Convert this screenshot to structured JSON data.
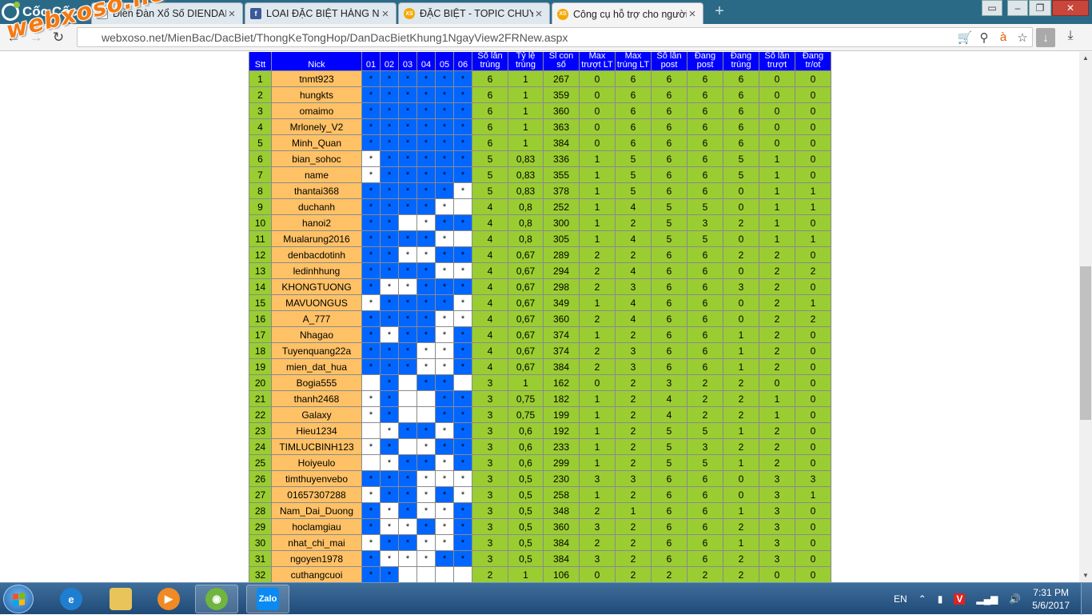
{
  "browser": {
    "brand": "Cốc Cốc",
    "tabs": [
      {
        "title": "Diễn Đàn Xổ Số DIENDAN",
        "icon": "page"
      },
      {
        "title": "LOAI ĐẶC BIỆT HÀNG NGÀY",
        "icon": "fb"
      },
      {
        "title": "ĐẶC BIỆT - TOPIC CHUYÊN",
        "icon": "xs"
      },
      {
        "title": "Công cụ hỗ trợ cho người",
        "icon": "xs"
      }
    ],
    "url": "webxoso.net/MienBac/DacBiet/ThongKeTongHop/DanDacBietKhung1NgayView2FRNew.aspx",
    "watermark": "webxoso.net"
  },
  "table": {
    "headers": [
      "Stt",
      "Nick",
      "01",
      "02",
      "03",
      "04",
      "05",
      "06",
      "Số lần trúng",
      "Tỷ lệ trúng",
      "Sl con số",
      "Max trượt LT",
      "Max trúng LT",
      "Số lần post",
      "Đang post",
      "Đang trúng",
      "Số lần trượt",
      "Đang tr/ot"
    ],
    "rows": [
      {
        "stt": "1",
        "nick": "tnmt923",
        "m": [
          1,
          1,
          1,
          1,
          1,
          1
        ],
        "v": [
          "6",
          "1",
          "267",
          "0",
          "6",
          "6",
          "6",
          "6",
          "0",
          "0"
        ]
      },
      {
        "stt": "2",
        "nick": "hungkts",
        "m": [
          1,
          1,
          1,
          1,
          1,
          1
        ],
        "v": [
          "6",
          "1",
          "359",
          "0",
          "6",
          "6",
          "6",
          "6",
          "0",
          "0"
        ]
      },
      {
        "stt": "3",
        "nick": "omaimo",
        "m": [
          1,
          1,
          1,
          1,
          1,
          1
        ],
        "v": [
          "6",
          "1",
          "360",
          "0",
          "6",
          "6",
          "6",
          "6",
          "0",
          "0"
        ]
      },
      {
        "stt": "4",
        "nick": "Mrlonely_V2",
        "m": [
          1,
          1,
          1,
          1,
          1,
          1
        ],
        "v": [
          "6",
          "1",
          "363",
          "0",
          "6",
          "6",
          "6",
          "6",
          "0",
          "0"
        ]
      },
      {
        "stt": "5",
        "nick": "Minh_Quan",
        "m": [
          1,
          1,
          1,
          1,
          1,
          1
        ],
        "v": [
          "6",
          "1",
          "384",
          "0",
          "6",
          "6",
          "6",
          "6",
          "0",
          "0"
        ]
      },
      {
        "stt": "6",
        "nick": "bian_sohoc",
        "m": [
          0,
          1,
          1,
          1,
          1,
          1
        ],
        "v": [
          "5",
          "0,83",
          "336",
          "1",
          "5",
          "6",
          "6",
          "5",
          "1",
          "0"
        ]
      },
      {
        "stt": "7",
        "nick": "name",
        "m": [
          0,
          1,
          1,
          1,
          1,
          1
        ],
        "v": [
          "5",
          "0,83",
          "355",
          "1",
          "5",
          "6",
          "6",
          "5",
          "1",
          "0"
        ]
      },
      {
        "stt": "8",
        "nick": "thantai368",
        "m": [
          1,
          1,
          1,
          1,
          1,
          0
        ],
        "v": [
          "5",
          "0,83",
          "378",
          "1",
          "5",
          "6",
          "6",
          "0",
          "1",
          "1"
        ]
      },
      {
        "stt": "9",
        "nick": "duchanh",
        "m": [
          1,
          1,
          1,
          1,
          0,
          2
        ],
        "v": [
          "4",
          "0,8",
          "252",
          "1",
          "4",
          "5",
          "5",
          "0",
          "1",
          "1"
        ]
      },
      {
        "stt": "10",
        "nick": "hanoi2",
        "m": [
          1,
          1,
          2,
          0,
          1,
          1
        ],
        "v": [
          "4",
          "0,8",
          "300",
          "1",
          "2",
          "5",
          "3",
          "2",
          "1",
          "0"
        ]
      },
      {
        "stt": "11",
        "nick": "Mualarung2016",
        "m": [
          1,
          1,
          1,
          1,
          0,
          2
        ],
        "v": [
          "4",
          "0,8",
          "305",
          "1",
          "4",
          "5",
          "5",
          "0",
          "1",
          "1"
        ]
      },
      {
        "stt": "12",
        "nick": "denbacdotinh",
        "m": [
          1,
          1,
          0,
          0,
          1,
          1
        ],
        "v": [
          "4",
          "0,67",
          "289",
          "2",
          "2",
          "6",
          "6",
          "2",
          "2",
          "0"
        ]
      },
      {
        "stt": "13",
        "nick": "ledinhhung",
        "m": [
          1,
          1,
          1,
          1,
          0,
          0
        ],
        "v": [
          "4",
          "0,67",
          "294",
          "2",
          "4",
          "6",
          "6",
          "0",
          "2",
          "2"
        ]
      },
      {
        "stt": "14",
        "nick": "KHONGTUONG",
        "m": [
          1,
          0,
          0,
          1,
          1,
          1
        ],
        "v": [
          "4",
          "0,67",
          "298",
          "2",
          "3",
          "6",
          "6",
          "3",
          "2",
          "0"
        ]
      },
      {
        "stt": "15",
        "nick": "MAVUONGUS",
        "m": [
          0,
          1,
          1,
          1,
          1,
          0
        ],
        "v": [
          "4",
          "0,67",
          "349",
          "1",
          "4",
          "6",
          "6",
          "0",
          "2",
          "1"
        ]
      },
      {
        "stt": "16",
        "nick": "A_777",
        "m": [
          1,
          1,
          1,
          1,
          0,
          0
        ],
        "v": [
          "4",
          "0,67",
          "360",
          "2",
          "4",
          "6",
          "6",
          "0",
          "2",
          "2"
        ]
      },
      {
        "stt": "17",
        "nick": "Nhagao",
        "m": [
          1,
          0,
          1,
          1,
          0,
          1
        ],
        "v": [
          "4",
          "0,67",
          "374",
          "1",
          "2",
          "6",
          "6",
          "1",
          "2",
          "0"
        ]
      },
      {
        "stt": "18",
        "nick": "Tuyenquang22a",
        "m": [
          1,
          1,
          1,
          0,
          0,
          1
        ],
        "v": [
          "4",
          "0,67",
          "374",
          "2",
          "3",
          "6",
          "6",
          "1",
          "2",
          "0"
        ]
      },
      {
        "stt": "19",
        "nick": "mien_dat_hua",
        "m": [
          1,
          1,
          1,
          0,
          0,
          1
        ],
        "v": [
          "4",
          "0,67",
          "384",
          "2",
          "3",
          "6",
          "6",
          "1",
          "2",
          "0"
        ]
      },
      {
        "stt": "20",
        "nick": "Bogia555",
        "m": [
          2,
          1,
          2,
          1,
          1,
          2
        ],
        "v": [
          "3",
          "1",
          "162",
          "0",
          "2",
          "3",
          "2",
          "2",
          "0",
          "0"
        ]
      },
      {
        "stt": "21",
        "nick": "thanh2468",
        "m": [
          0,
          1,
          2,
          2,
          1,
          1
        ],
        "v": [
          "3",
          "0,75",
          "182",
          "1",
          "2",
          "4",
          "2",
          "2",
          "1",
          "0"
        ]
      },
      {
        "stt": "22",
        "nick": "Galaxy",
        "m": [
          0,
          1,
          2,
          2,
          1,
          1
        ],
        "v": [
          "3",
          "0,75",
          "199",
          "1",
          "2",
          "4",
          "2",
          "2",
          "1",
          "0"
        ]
      },
      {
        "stt": "23",
        "nick": "Hieu1234",
        "m": [
          2,
          0,
          1,
          1,
          0,
          1
        ],
        "v": [
          "3",
          "0,6",
          "192",
          "1",
          "2",
          "5",
          "5",
          "1",
          "2",
          "0"
        ]
      },
      {
        "stt": "24",
        "nick": "TIMLUCBINH123",
        "m": [
          0,
          1,
          2,
          0,
          1,
          1
        ],
        "v": [
          "3",
          "0,6",
          "233",
          "1",
          "2",
          "5",
          "3",
          "2",
          "2",
          "0"
        ]
      },
      {
        "stt": "25",
        "nick": "Hoiyeulo",
        "m": [
          2,
          0,
          1,
          1,
          0,
          1
        ],
        "v": [
          "3",
          "0,6",
          "299",
          "1",
          "2",
          "5",
          "5",
          "1",
          "2",
          "0"
        ]
      },
      {
        "stt": "26",
        "nick": "timthuyenvebo",
        "m": [
          1,
          1,
          1,
          0,
          0,
          0
        ],
        "v": [
          "3",
          "0,5",
          "230",
          "3",
          "3",
          "6",
          "6",
          "0",
          "3",
          "3"
        ]
      },
      {
        "stt": "27",
        "nick": "01657307288",
        "m": [
          0,
          1,
          1,
          0,
          1,
          0
        ],
        "v": [
          "3",
          "0,5",
          "258",
          "1",
          "2",
          "6",
          "6",
          "0",
          "3",
          "1"
        ]
      },
      {
        "stt": "28",
        "nick": "Nam_Dai_Duong",
        "m": [
          1,
          0,
          1,
          0,
          0,
          1
        ],
        "v": [
          "3",
          "0,5",
          "348",
          "2",
          "1",
          "6",
          "6",
          "1",
          "3",
          "0"
        ]
      },
      {
        "stt": "29",
        "nick": "hoclamgiau",
        "m": [
          1,
          0,
          0,
          1,
          0,
          1
        ],
        "v": [
          "3",
          "0,5",
          "360",
          "3",
          "2",
          "6",
          "6",
          "2",
          "3",
          "0"
        ]
      },
      {
        "stt": "30",
        "nick": "nhat_chi_mai",
        "m": [
          0,
          1,
          1,
          0,
          0,
          1
        ],
        "v": [
          "3",
          "0,5",
          "384",
          "2",
          "2",
          "6",
          "6",
          "1",
          "3",
          "0"
        ]
      },
      {
        "stt": "31",
        "nick": "ngoyen1978",
        "m": [
          1,
          0,
          0,
          0,
          1,
          1
        ],
        "v": [
          "3",
          "0,5",
          "384",
          "3",
          "2",
          "6",
          "6",
          "2",
          "3",
          "0"
        ]
      },
      {
        "stt": "32",
        "nick": "cuthangcuoi",
        "m": [
          1,
          1,
          2,
          2,
          2,
          2
        ],
        "v": [
          "2",
          "1",
          "106",
          "0",
          "2",
          "2",
          "2",
          "2",
          "0",
          "0"
        ]
      }
    ]
  },
  "taskbar": {
    "zalo": "Zalo",
    "lang": "EN",
    "time": "7:31 PM",
    "date": "5/6/2017",
    "accent": "#1f4a78"
  }
}
